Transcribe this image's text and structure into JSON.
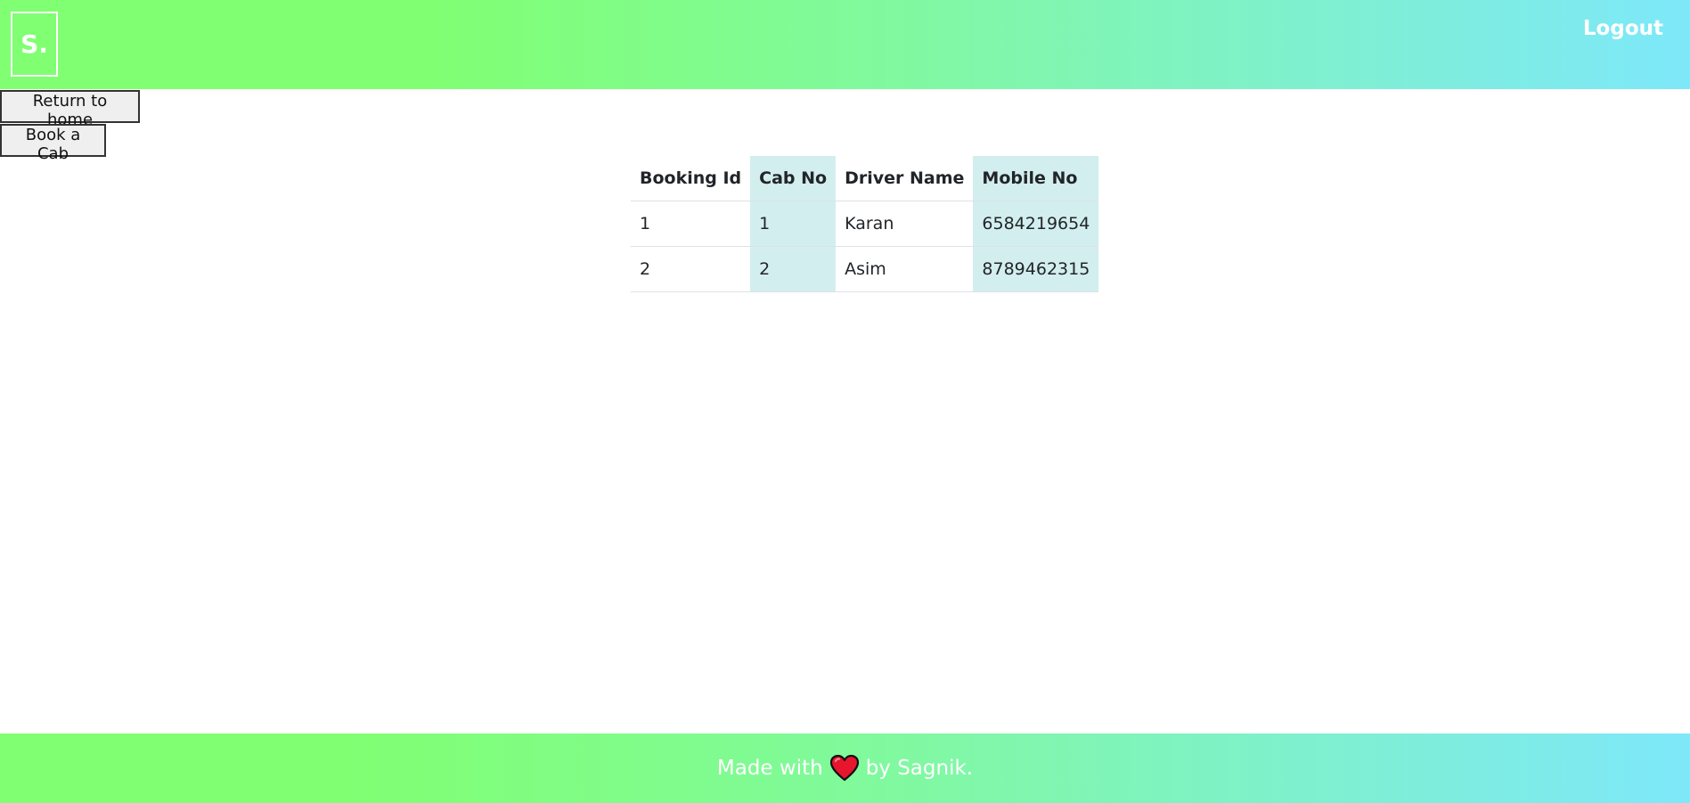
{
  "header": {
    "logo_text": "S.",
    "logout_label": "Logout"
  },
  "actions": {
    "return_home_label": "Return to home",
    "book_cab_label": "Book a Cab"
  },
  "table": {
    "headers": [
      "Booking Id",
      "Cab No",
      "Driver Name",
      "Mobile No"
    ],
    "rows": [
      [
        "1",
        "1",
        "Karan",
        "6584219654"
      ],
      [
        "2",
        "2",
        "Asim",
        "8789462315"
      ]
    ]
  },
  "footer": {
    "prefix": "Made with",
    "suffix": "by Sagnik.",
    "heart_icon": "heart-icon"
  },
  "colors": {
    "gradient_start": "#80ff72",
    "gradient_end": "#7ee8fa",
    "shaded_column": "#d3eeee",
    "heart": "#e8152e"
  }
}
